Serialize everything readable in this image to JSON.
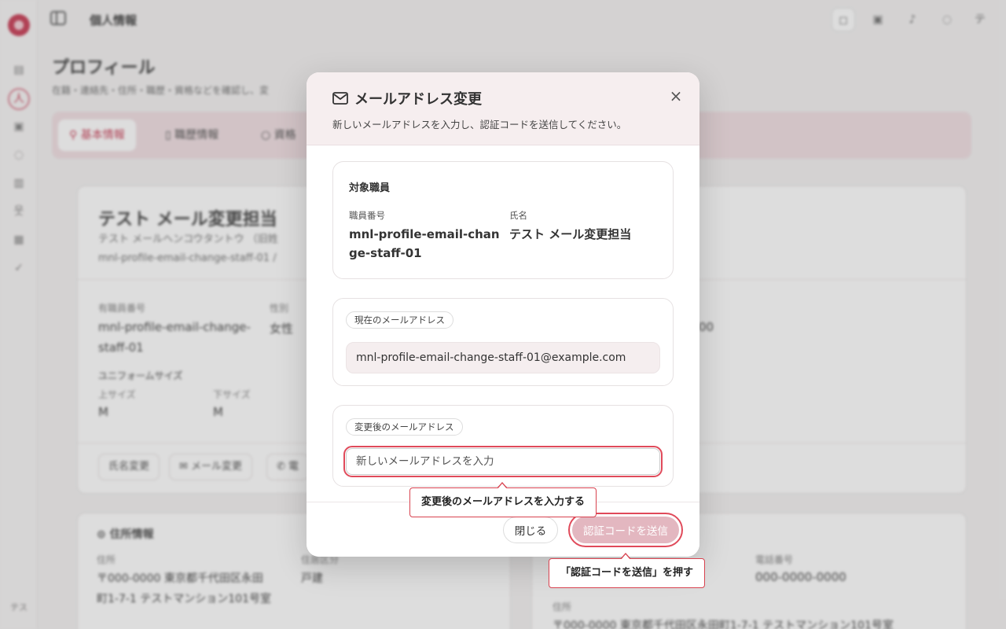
{
  "app": {
    "header_title": "個人情報",
    "rail_avatar": "テス",
    "top_avatar": "テ"
  },
  "background": {
    "page_title": "プロフィール",
    "page_subtitle": "在籍・連絡先・住所・職歴・資格などを確認し、変",
    "tabs": [
      {
        "label": "基本情報"
      },
      {
        "label": "職歴情報"
      },
      {
        "label": "資格"
      }
    ],
    "profile": {
      "name": "テスト メール変更担当",
      "kana": "テスト メールヘンコウタントウ （旧姓",
      "id_line": "mnl-profile-email-change-staff-01 /",
      "staff_no_label": "有職員番号",
      "staff_no_value_1": "mnl-profile-email-change-",
      "staff_no_value_2": "staff-01",
      "gender_label": "性別",
      "gender_value": "女性",
      "side_value": "00",
      "uniform_label": "ユニフォームサイズ",
      "upper_label": "上サイズ",
      "upper_value": "M",
      "lower_label": "下サイズ",
      "lower_value": "M",
      "buttons": [
        "氏名変更",
        "メール変更",
        "電"
      ]
    },
    "address": {
      "title": "住所情報",
      "address_label": "住所",
      "address_line1": "〒000-0000 東京都千代田区永田",
      "address_line2": "町1-7-1 テストマンション101号室",
      "type_label": "住居区分",
      "type_value": "戸建",
      "phone_label": "電話番号",
      "phone_value": "000-0000-0000",
      "right_address_label": "住所",
      "right_address_value": "〒000-0000 東京都千代田区永田町1-7-1 テストマンション101号室"
    }
  },
  "modal": {
    "title": "メールアドレス変更",
    "description": "新しいメールアドレスを入力し、認証コードを送信してください。",
    "target": {
      "title": "対象職員",
      "staff_no_label": "職員番号",
      "staff_no_line1": "mnl-profile-email-chan",
      "staff_no_line2": "ge-staff-01",
      "name_label": "氏名",
      "name_value": "テスト メール変更担当"
    },
    "current": {
      "label": "現在のメールアドレス",
      "value": "mnl-profile-email-change-staff-01@example.com"
    },
    "new_email": {
      "label": "変更後のメールアドレス",
      "placeholder": "新しいメールアドレスを入力"
    },
    "close_label": "閉じる",
    "send_label": "認証コードを送信"
  },
  "callouts": {
    "input_hint": "変更後のメールアドレスを入力する",
    "send_hint": "「認証コードを送信」を押す"
  },
  "colors": {
    "accent": "#c4304a",
    "highlight": "#e04a5a",
    "send_button_disabled": "#e3b7c0"
  }
}
